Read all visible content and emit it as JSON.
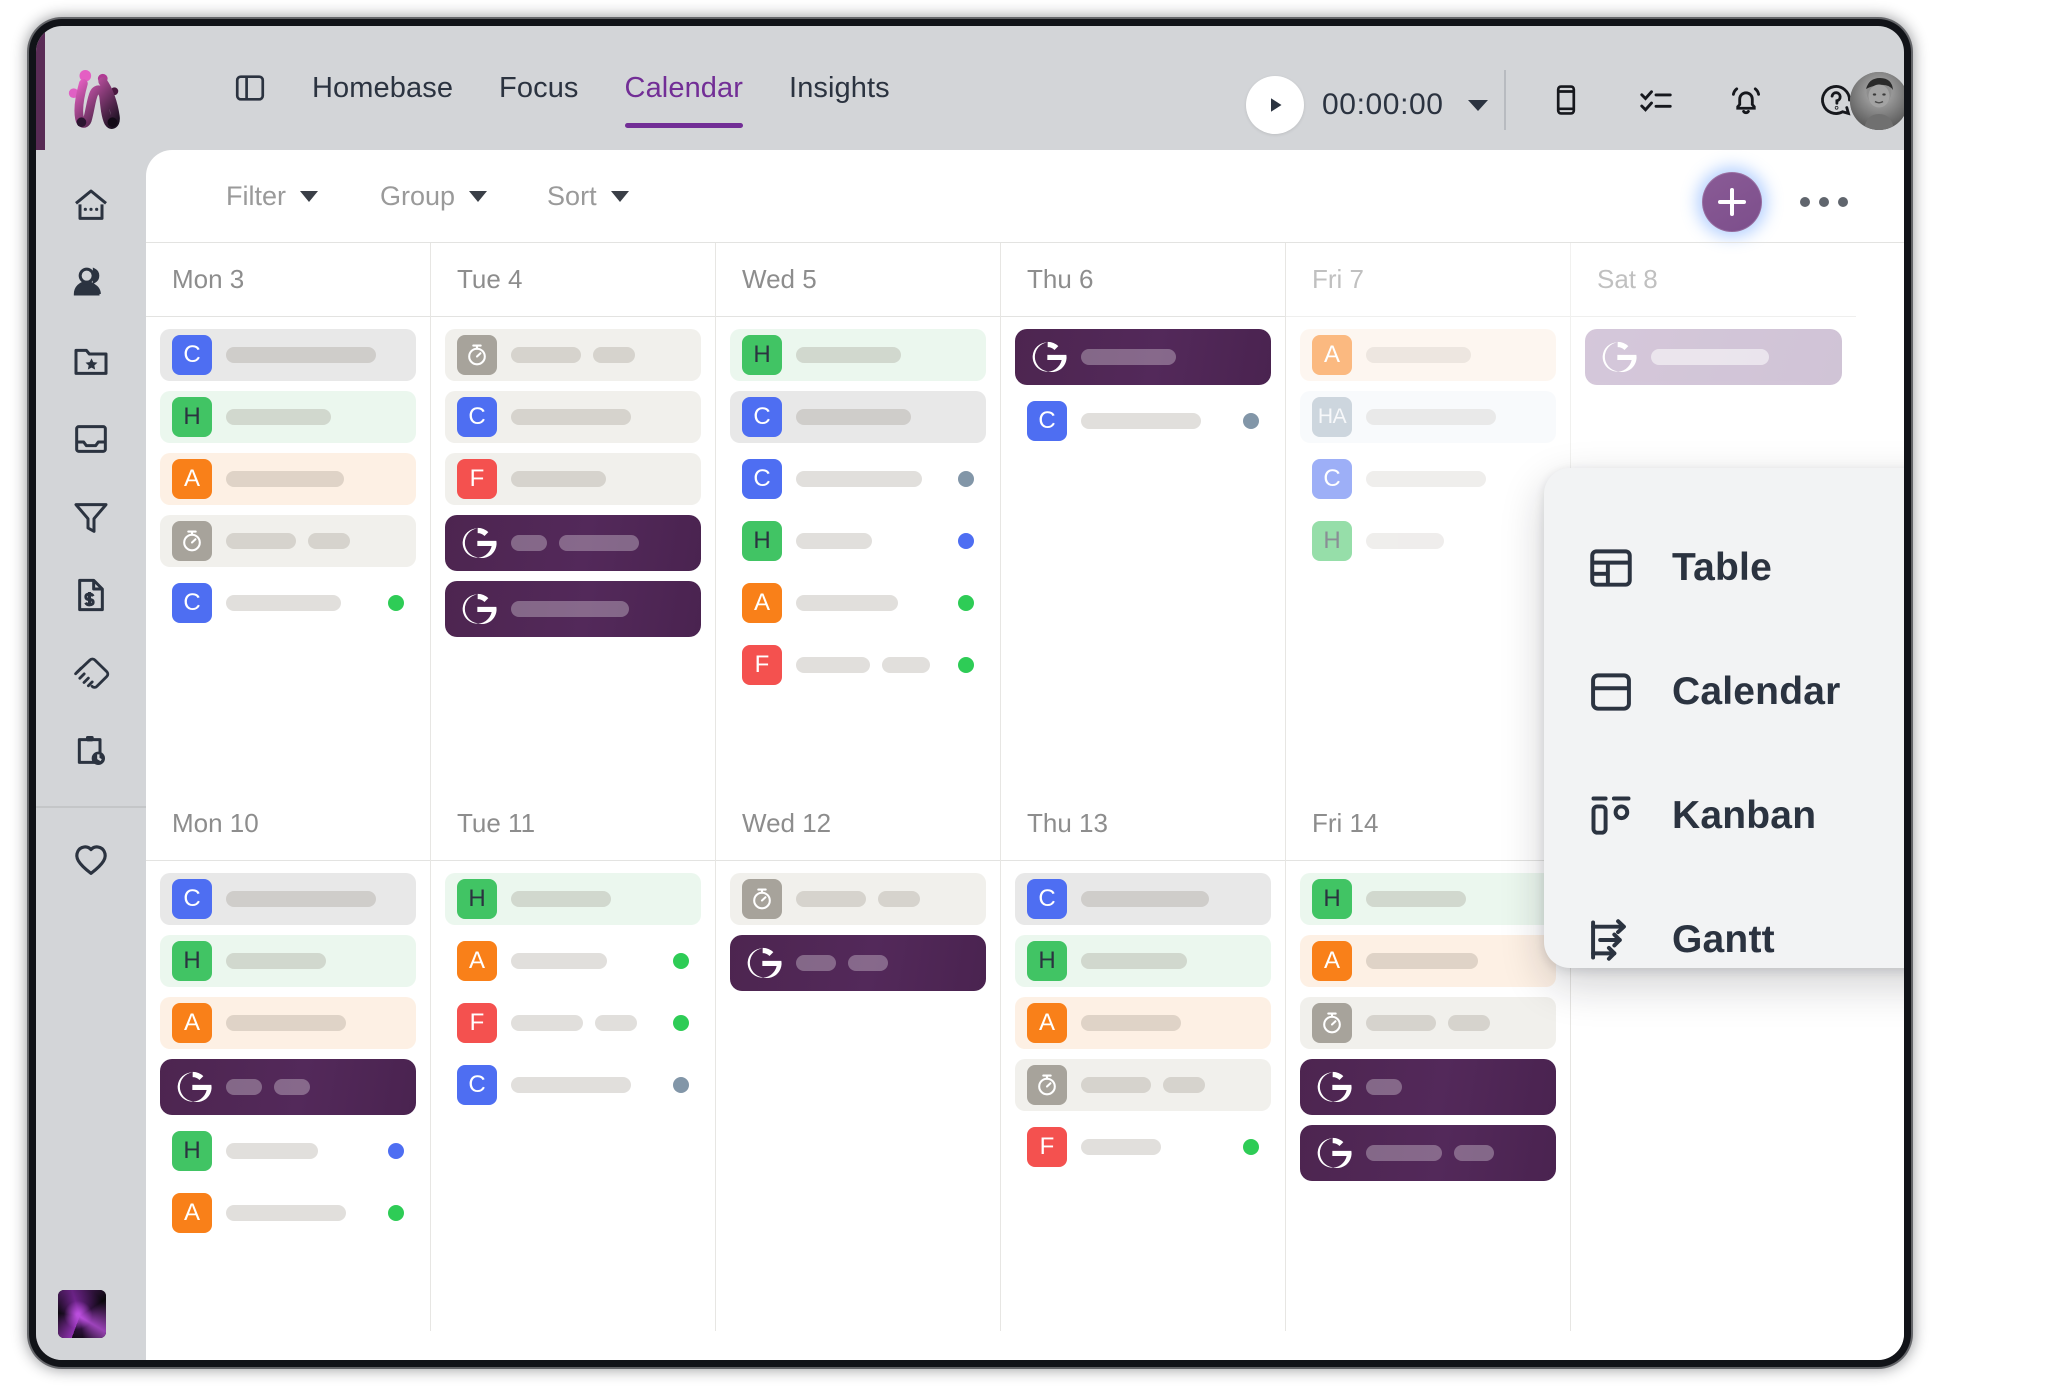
{
  "app": {
    "brand_name": "marker-logo",
    "nav_tabs": [
      {
        "label": "Homebase",
        "active": false
      },
      {
        "label": "Focus",
        "active": false
      },
      {
        "label": "Calendar",
        "active": true
      },
      {
        "label": "Insights",
        "active": false
      }
    ],
    "timer": {
      "value": "00:00:00"
    },
    "topbar_icons": [
      "mobile-icon",
      "checklist-icon",
      "bell-icon",
      "help-icon"
    ],
    "accent_color": "#722e96",
    "purple_event_color": "#4d2550"
  },
  "sidebar": {
    "items": [
      {
        "icon": "home-icon",
        "label": "Homebase"
      },
      {
        "icon": "people-icon",
        "label": "People"
      },
      {
        "icon": "folder-star-icon",
        "label": "Projects"
      },
      {
        "icon": "inbox-icon",
        "label": "Inbox"
      },
      {
        "icon": "funnel-icon",
        "label": "Pipeline"
      },
      {
        "icon": "invoice-icon",
        "label": "Invoices"
      },
      {
        "icon": "handshake-icon",
        "label": "Deals"
      },
      {
        "icon": "clipboard-clock-icon",
        "label": "Timesheets"
      },
      {
        "icon": "heart-icon",
        "label": "Favorites"
      }
    ],
    "bottom_item": {
      "icon": "workspace-thumbnail",
      "label": "Workspace"
    }
  },
  "toolbar": {
    "filter_label": "Filter",
    "group_label": "Group",
    "sort_label": "Sort",
    "add_label": "+",
    "more_label": "•••"
  },
  "view_menu": {
    "items": [
      {
        "icon": "table-icon",
        "label": "Table"
      },
      {
        "icon": "calendar-icon",
        "label": "Calendar"
      },
      {
        "icon": "kanban-icon",
        "label": "Kanban"
      },
      {
        "icon": "gantt-icon",
        "label": "Gantt"
      }
    ]
  },
  "calendar": {
    "weeks": [
      {
        "days": [
          {
            "header": "Mon 3",
            "faded": false,
            "events": [
              {
                "chip": "C",
                "chip_class": "c-c",
                "bg": "bg-grey",
                "bars": [
                  150
                ],
                "dot": null
              },
              {
                "chip": "H",
                "chip_class": "c-h",
                "bg": "bg-green",
                "bars": [
                  105
                ],
                "dot": null
              },
              {
                "chip": "A",
                "chip_class": "c-a",
                "bg": "bg-peach",
                "bars": [
                  118
                ],
                "dot": null
              },
              {
                "chip": "T",
                "chip_class": "c-t",
                "bg": "bg-stone",
                "bars": [
                  70,
                  42
                ],
                "dot": null
              },
              {
                "chip": "C",
                "chip_class": "c-c",
                "bg": "bg-none",
                "bars": [
                  115
                ],
                "dot": "d-green"
              }
            ]
          },
          {
            "header": "Tue 4",
            "faded": false,
            "events": [
              {
                "chip": "T",
                "chip_class": "c-t",
                "bg": "bg-stone",
                "bars": [
                  70,
                  42
                ],
                "dot": null
              },
              {
                "chip": "C",
                "chip_class": "c-c",
                "bg": "bg-stone",
                "bars": [
                  120
                ],
                "dot": null
              },
              {
                "chip": "F",
                "chip_class": "c-f",
                "bg": "bg-stone",
                "bars": [
                  95
                ],
                "dot": null
              },
              {
                "chip": "G",
                "chip_class": "g",
                "bg": "g-card",
                "bars": [
                  36,
                  80
                ],
                "dot": null
              },
              {
                "chip": "G",
                "chip_class": "g",
                "bg": "g-card",
                "bars": [
                  118
                ],
                "dot": null
              }
            ]
          },
          {
            "header": "Wed 5",
            "faded": false,
            "events": [
              {
                "chip": "H",
                "chip_class": "c-h",
                "bg": "bg-green",
                "bars": [
                  105
                ],
                "dot": null
              },
              {
                "chip": "C",
                "chip_class": "c-c",
                "bg": "bg-grey",
                "bars": [
                  115
                ],
                "dot": null
              },
              {
                "chip": "C",
                "chip_class": "c-c",
                "bg": "bg-none",
                "bars": [
                  126
                ],
                "dot": "d-slate"
              },
              {
                "chip": "H",
                "chip_class": "c-h",
                "bg": "bg-none",
                "bars": [
                  76
                ],
                "dot": "d-blue"
              },
              {
                "chip": "A",
                "chip_class": "c-a",
                "bg": "bg-none",
                "bars": [
                  102
                ],
                "dot": "d-green"
              },
              {
                "chip": "F",
                "chip_class": "c-f",
                "bg": "bg-none",
                "bars": [
                  74,
                  48
                ],
                "dot": "d-green"
              }
            ]
          },
          {
            "header": "Thu 6",
            "faded": false,
            "events": [
              {
                "chip": "G",
                "chip_class": "g",
                "bg": "g-card",
                "bars": [
                  95
                ],
                "dot": null
              },
              {
                "chip": "C",
                "chip_class": "c-c",
                "bg": "bg-none",
                "bars": [
                  120
                ],
                "dot": "d-slate"
              }
            ]
          },
          {
            "header": "Fri 7",
            "faded": true,
            "events": [
              {
                "chip": "A",
                "chip_class": "c-a",
                "bg": "bg-peach",
                "bars": [
                  105
                ],
                "dot": null
              },
              {
                "chip": "HA",
                "chip_class": "c-ha",
                "bg": "bg-blue",
                "bars": [
                  130
                ],
                "dot": null
              },
              {
                "chip": "C",
                "chip_class": "c-c",
                "bg": "bg-none",
                "bars": [
                  120
                ],
                "dot": null
              },
              {
                "chip": "H",
                "chip_class": "c-h",
                "bg": "bg-none",
                "bars": [
                  78
                ],
                "dot": null
              }
            ]
          },
          {
            "header": "Sat 8",
            "faded": true,
            "events": [
              {
                "chip": "G",
                "chip_class": "g",
                "bg": "g-card g-soft",
                "bars": [
                  118
                ],
                "dot": null
              }
            ]
          }
        ]
      },
      {
        "days": [
          {
            "header": "Mon 10",
            "faded": false,
            "events": [
              {
                "chip": "C",
                "chip_class": "c-c",
                "bg": "bg-grey",
                "bars": [
                  150
                ],
                "dot": null
              },
              {
                "chip": "H",
                "chip_class": "c-h",
                "bg": "bg-green",
                "bars": [
                  100
                ],
                "dot": null
              },
              {
                "chip": "A",
                "chip_class": "c-a",
                "bg": "bg-peach",
                "bars": [
                  120
                ],
                "dot": null
              },
              {
                "chip": "G",
                "chip_class": "g",
                "bg": "g-card",
                "bars": [
                  36,
                  36
                ],
                "dot": null
              },
              {
                "chip": "H",
                "chip_class": "c-h",
                "bg": "bg-none",
                "bars": [
                  92
                ],
                "dot": "d-blue"
              },
              {
                "chip": "A",
                "chip_class": "c-a",
                "bg": "bg-none",
                "bars": [
                  120
                ],
                "dot": "d-green"
              }
            ]
          },
          {
            "header": "Tue 11",
            "faded": false,
            "events": [
              {
                "chip": "H",
                "chip_class": "c-h",
                "bg": "bg-green",
                "bars": [
                  100
                ],
                "dot": null
              },
              {
                "chip": "A",
                "chip_class": "c-a",
                "bg": "bg-none",
                "bars": [
                  96
                ],
                "dot": "d-green"
              },
              {
                "chip": "F",
                "chip_class": "c-f",
                "bg": "bg-none",
                "bars": [
                  72,
                  42
                ],
                "dot": "d-green"
              },
              {
                "chip": "C",
                "chip_class": "c-c",
                "bg": "bg-none",
                "bars": [
                  120
                ],
                "dot": "d-slate"
              }
            ]
          },
          {
            "header": "Wed 12",
            "faded": false,
            "events": [
              {
                "chip": "T",
                "chip_class": "c-t",
                "bg": "bg-stone",
                "bars": [
                  70,
                  42
                ],
                "dot": null
              },
              {
                "chip": "G",
                "chip_class": "g",
                "bg": "g-card",
                "bars": [
                  40,
                  40
                ],
                "dot": null
              }
            ]
          },
          {
            "header": "Thu 13",
            "faded": false,
            "events": [
              {
                "chip": "C",
                "chip_class": "c-c",
                "bg": "bg-grey",
                "bars": [
                  128
                ],
                "dot": null
              },
              {
                "chip": "H",
                "chip_class": "c-h",
                "bg": "bg-green",
                "bars": [
                  106
                ],
                "dot": null
              },
              {
                "chip": "A",
                "chip_class": "c-a",
                "bg": "bg-peach",
                "bars": [
                  100
                ],
                "dot": null
              },
              {
                "chip": "T",
                "chip_class": "c-t",
                "bg": "bg-stone",
                "bars": [
                  70,
                  42
                ],
                "dot": null
              },
              {
                "chip": "F",
                "chip_class": "c-f",
                "bg": "bg-none",
                "bars": [
                  80
                ],
                "dot": "d-green"
              }
            ]
          },
          {
            "header": "Fri 14",
            "faded": false,
            "events": [
              {
                "chip": "H",
                "chip_class": "c-h",
                "bg": "bg-green",
                "bars": [
                  100
                ],
                "dot": null
              },
              {
                "chip": "A",
                "chip_class": "c-a",
                "bg": "bg-peach",
                "bars": [
                  112
                ],
                "dot": null
              },
              {
                "chip": "T",
                "chip_class": "c-t",
                "bg": "bg-stone",
                "bars": [
                  70,
                  42
                ],
                "dot": null
              },
              {
                "chip": "G",
                "chip_class": "g",
                "bg": "g-card",
                "bars": [
                  36
                ],
                "dot": null
              },
              {
                "chip": "G",
                "chip_class": "g",
                "bg": "g-card",
                "bars": [
                  76,
                  40
                ],
                "dot": null
              }
            ]
          },
          {
            "header": "",
            "faded": false,
            "events": []
          }
        ]
      }
    ]
  }
}
